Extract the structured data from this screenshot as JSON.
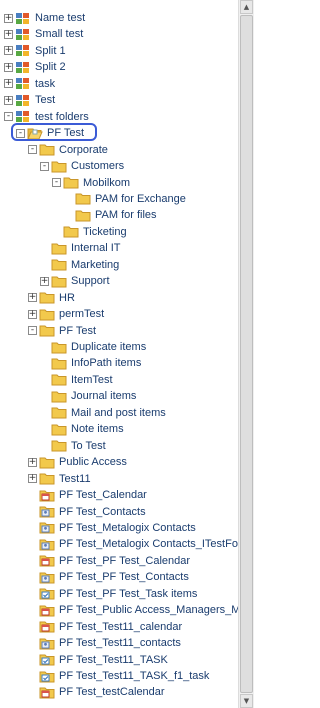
{
  "tree": {
    "items": [
      {
        "label": "Name test",
        "depth": 0,
        "toggle": "+",
        "icon": "site"
      },
      {
        "label": "Small test",
        "depth": 0,
        "toggle": "+",
        "icon": "site"
      },
      {
        "label": "Split 1",
        "depth": 0,
        "toggle": "+",
        "icon": "site"
      },
      {
        "label": "Split 2",
        "depth": 0,
        "toggle": "+",
        "icon": "site"
      },
      {
        "label": "task",
        "depth": 0,
        "toggle": "+",
        "icon": "site"
      },
      {
        "label": "Test",
        "depth": 0,
        "toggle": "+",
        "icon": "site"
      },
      {
        "label": "test folders",
        "depth": 0,
        "toggle": "-",
        "icon": "site"
      },
      {
        "label": "PF Test",
        "depth": 1,
        "toggle": "-",
        "icon": "folder-open",
        "selected": true
      },
      {
        "label": "Corporate",
        "depth": 2,
        "toggle": "-",
        "icon": "folder"
      },
      {
        "label": "Customers",
        "depth": 3,
        "toggle": "-",
        "icon": "folder"
      },
      {
        "label": "Mobilkom",
        "depth": 4,
        "toggle": "-",
        "icon": "folder"
      },
      {
        "label": "PAM for Exchange",
        "depth": 5,
        "toggle": "",
        "icon": "folder"
      },
      {
        "label": "PAM for files",
        "depth": 5,
        "toggle": "",
        "icon": "folder"
      },
      {
        "label": "Ticketing",
        "depth": 4,
        "toggle": "",
        "icon": "folder"
      },
      {
        "label": "Internal IT",
        "depth": 3,
        "toggle": "",
        "icon": "folder"
      },
      {
        "label": "Marketing",
        "depth": 3,
        "toggle": "",
        "icon": "folder"
      },
      {
        "label": "Support",
        "depth": 3,
        "toggle": "+",
        "icon": "folder"
      },
      {
        "label": "HR",
        "depth": 2,
        "toggle": "+",
        "icon": "folder"
      },
      {
        "label": "permTest",
        "depth": 2,
        "toggle": "+",
        "icon": "folder"
      },
      {
        "label": "PF Test",
        "depth": 2,
        "toggle": "-",
        "icon": "folder"
      },
      {
        "label": "Duplicate items",
        "depth": 3,
        "toggle": "",
        "icon": "folder"
      },
      {
        "label": "InfoPath items",
        "depth": 3,
        "toggle": "",
        "icon": "folder"
      },
      {
        "label": "ItemTest",
        "depth": 3,
        "toggle": "",
        "icon": "folder"
      },
      {
        "label": "Journal items",
        "depth": 3,
        "toggle": "",
        "icon": "folder"
      },
      {
        "label": "Mail and post items",
        "depth": 3,
        "toggle": "",
        "icon": "folder"
      },
      {
        "label": "Note items",
        "depth": 3,
        "toggle": "",
        "icon": "folder"
      },
      {
        "label": "To Test",
        "depth": 3,
        "toggle": "",
        "icon": "folder"
      },
      {
        "label": "Public Access",
        "depth": 2,
        "toggle": "+",
        "icon": "folder"
      },
      {
        "label": "Test11",
        "depth": 2,
        "toggle": "+",
        "icon": "folder"
      },
      {
        "label": "PF Test_Calendar",
        "depth": 2,
        "toggle": "",
        "icon": "calendar"
      },
      {
        "label": "PF Test_Contacts",
        "depth": 2,
        "toggle": "",
        "icon": "contacts"
      },
      {
        "label": "PF Test_Metalogix Contacts",
        "depth": 2,
        "toggle": "",
        "icon": "contacts"
      },
      {
        "label": "PF Test_Metalogix Contacts_ITestFolder",
        "depth": 2,
        "toggle": "",
        "icon": "contacts"
      },
      {
        "label": "PF Test_PF Test_Calendar",
        "depth": 2,
        "toggle": "",
        "icon": "calendar"
      },
      {
        "label": "PF Test_PF Test_Contacts",
        "depth": 2,
        "toggle": "",
        "icon": "contacts"
      },
      {
        "label": "PF Test_PF Test_Task items",
        "depth": 2,
        "toggle": "",
        "icon": "task"
      },
      {
        "label": "PF Test_Public Access_Managers_Meetings",
        "depth": 2,
        "toggle": "",
        "icon": "calendar"
      },
      {
        "label": "PF Test_Test11_calendar",
        "depth": 2,
        "toggle": "",
        "icon": "calendar"
      },
      {
        "label": "PF Test_Test11_contacts",
        "depth": 2,
        "toggle": "",
        "icon": "contacts"
      },
      {
        "label": "PF Test_Test11_TASK",
        "depth": 2,
        "toggle": "",
        "icon": "task"
      },
      {
        "label": "PF Test_Test11_TASK_f1_task",
        "depth": 2,
        "toggle": "",
        "icon": "task"
      },
      {
        "label": "PF Test_testCalendar",
        "depth": 2,
        "toggle": "",
        "icon": "calendar"
      }
    ]
  },
  "scrollbar": {
    "up_icon": "arrow-up-icon",
    "down_icon": "arrow-down-icon"
  },
  "colors": {
    "text": "#1a3c6e",
    "selection": "#3b5bd6",
    "folder": "#f2c94c",
    "background": "#ffffff"
  }
}
